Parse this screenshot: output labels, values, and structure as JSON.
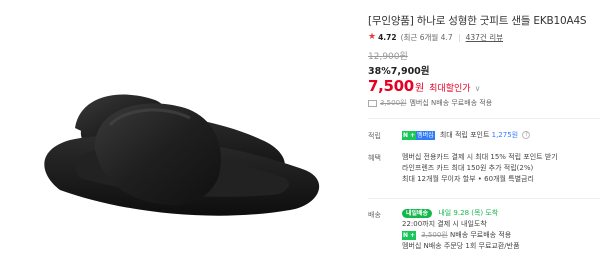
{
  "product": {
    "title": "[무인양품] 하나로 성형한 굿피트 샌들 EKB10A4S",
    "rating": {
      "star": "★",
      "score": "4.72",
      "recent": "(최근 6개월 4.7",
      "reviews": "437건 리뷰"
    },
    "price": {
      "original": "12,900원",
      "discount": "38%7,900원",
      "final": "7,500",
      "final_unit": "원",
      "final_label": "최대할인가",
      "chevron": "∨"
    },
    "membership_coupon": {
      "strike": "3,500원",
      "text": "멤버십 N배송 무료배송 적용"
    }
  },
  "benefits": {
    "points_label": "적립",
    "points_badge_n": "N",
    "points_badge_plus": "+",
    "points_badge_pay": "멤버십",
    "points_text": "최대 적립 포인트",
    "points_value": "1,275원",
    "benefit_label": "혜택",
    "benefit_lines": [
      "멤버십 전용카드 결제 시 최대 15% 적립 포인트 받기",
      "라인프렌즈 카드 최대 150원 추가 적립(2%)",
      "최대 12개월 무이자 할부 • 60개월 특별금리"
    ]
  },
  "shipping": {
    "label": "배송",
    "badge": "내일배송",
    "arrival": "내일 9.28 (목) 도착",
    "cutoff": "22:00까지 결제 시 내일도착",
    "fee_strike": "3,500원",
    "fee_text": "N배송 무료배송 적용",
    "return_text": "멤버십 N배송 주문당 1회 무료교환/반품"
  },
  "colors": {
    "accent_red": "#e60023",
    "star": "#e63e3e",
    "npay_green": "#19c65a",
    "link_blue": "#2f7df6"
  }
}
